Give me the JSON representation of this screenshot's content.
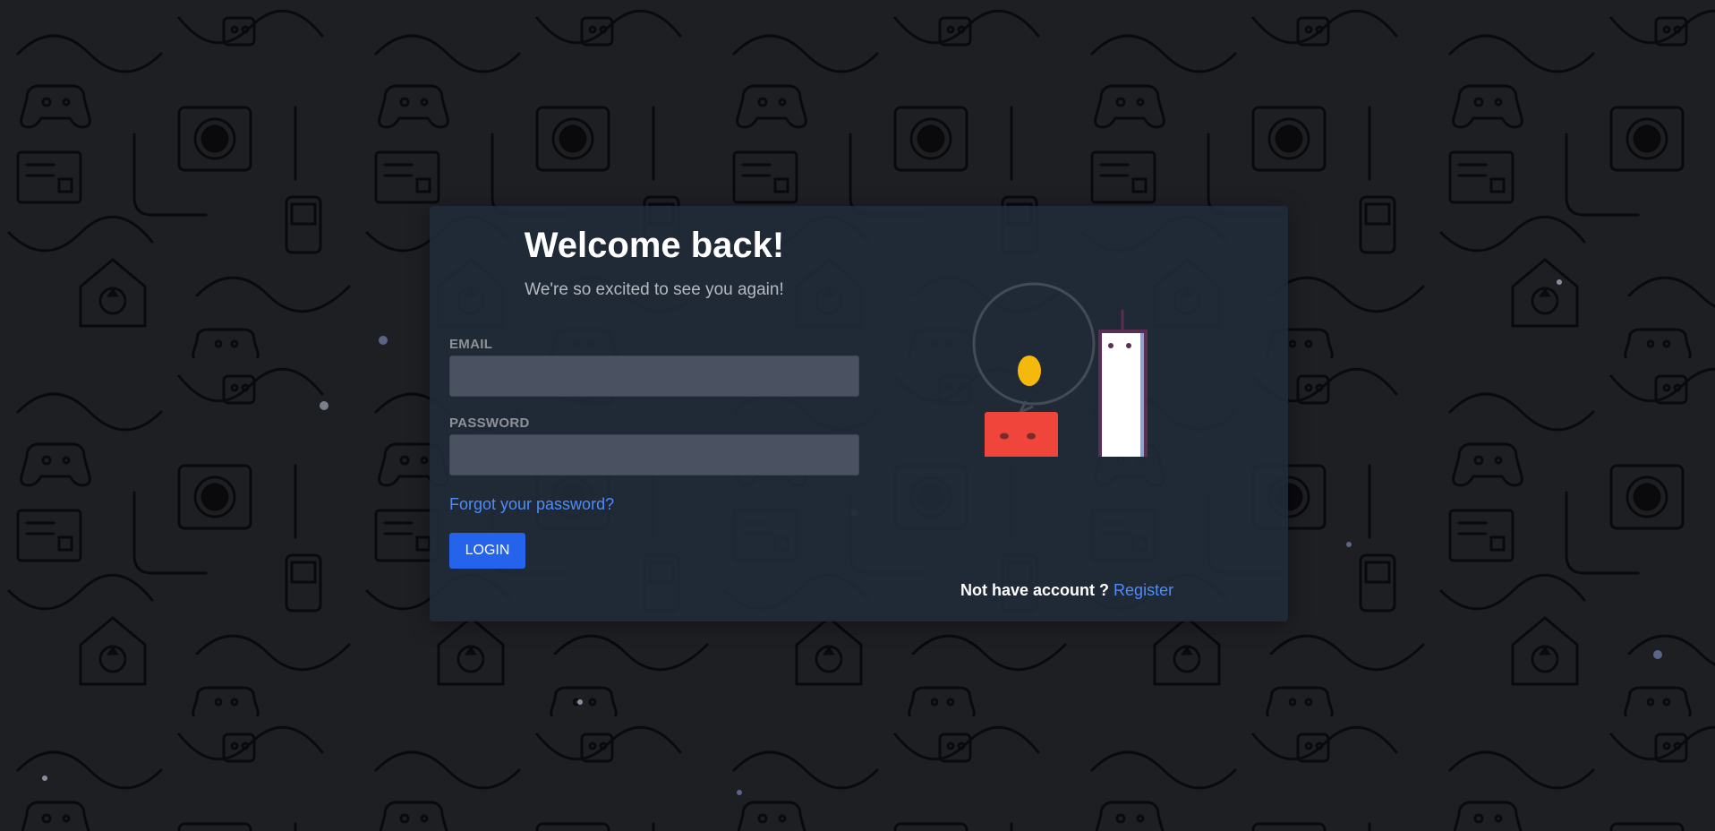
{
  "login": {
    "title": "Welcome back!",
    "subtitle": "We're so excited to see you again!",
    "email_label": "EMAIL",
    "email_value": "",
    "password_label": "PASSWORD",
    "password_value": "",
    "forgot_label": "Forgot your password?",
    "login_label": "LOGIN"
  },
  "register": {
    "prompt": "Not have account ?",
    "link_label": "Register"
  },
  "colors": {
    "background": "#1e1f23",
    "card": "#202a38",
    "accent": "#2563eb",
    "link": "#4f8cf7",
    "red_block": "#f0453a",
    "egg": "#f5b90c",
    "shelf": "#5a2d52"
  }
}
